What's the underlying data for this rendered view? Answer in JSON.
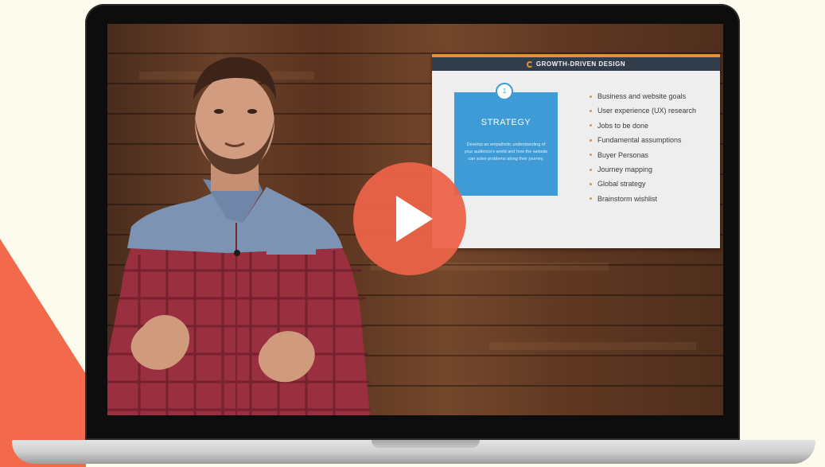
{
  "slide": {
    "header": "GROWTH-DRIVEN DESIGN",
    "step_number": "1",
    "box_title": "STRATEGY",
    "box_description": "Develop an empathetic understanding of your audience's world and how the website can solve problems along their journey.",
    "bullets": [
      "Business and website goals",
      "User experience (UX) research",
      "Jobs to be done",
      "Fundamental assumptions",
      "Buyer Personas",
      "Journey mapping",
      "Global strategy",
      "Brainstorm wishlist"
    ]
  },
  "player": {
    "play_icon": "play-icon"
  },
  "colors": {
    "accent": "#ec6348",
    "background": "#fdfbee",
    "slide_header": "#323d4c",
    "strategy_box": "#3e9bd6",
    "bullet": "#e8912f"
  }
}
